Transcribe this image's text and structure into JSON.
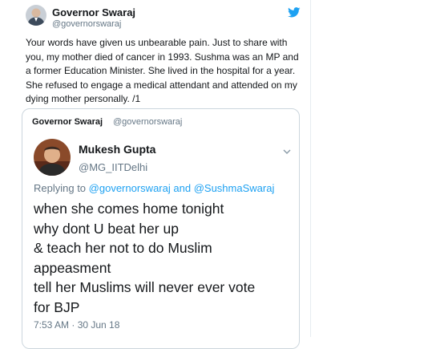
{
  "tweet": {
    "author_name": "Governor Swaraj",
    "author_handle": "@governorswaraj",
    "text": "Your words have given us unbearable pain. Just to share with you, my mother died of cancer in 1993. Sushma was an MP and a former Education Minister. She lived in the hospital for a year. She refused to engage a medical attendant and attended on my dying mother personally. /1",
    "brand_icon": "twitter-bird-icon",
    "brand_color": "#1da1f2"
  },
  "quote": {
    "author_name": "Governor Swaraj",
    "author_handle": "@governorswaraj",
    "embedded": {
      "author_name": "Mukesh Gupta",
      "author_handle": "@MG_IITDelhi",
      "replying_prefix": "Replying to",
      "reply_to_1": "@governorswaraj",
      "reply_and": "and",
      "reply_to_2": "@SushmaSwaraj",
      "text_lines": [
        "when she comes home tonight",
        "why dont U beat her up",
        "& teach her not to do Muslim",
        "appeasment",
        "tell her Muslims will never ever vote",
        "for BJP"
      ],
      "timestamp": "7:53 AM · 30 Jun 18",
      "menu_icon": "chevron-down-icon",
      "link_color": "#1da1f2"
    }
  }
}
